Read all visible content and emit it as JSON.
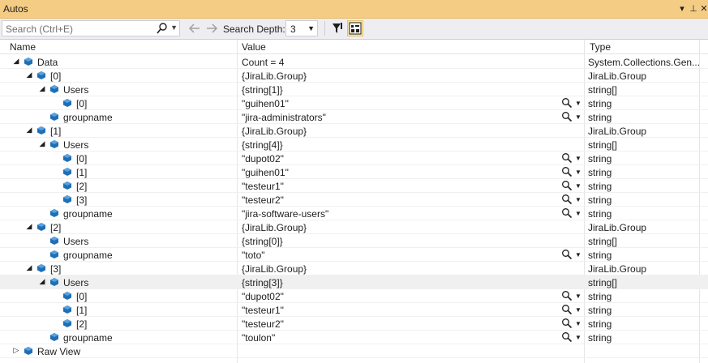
{
  "window": {
    "title": "Autos",
    "menu_icon": "▾",
    "pin_icon": "⊥",
    "close_icon": "✕"
  },
  "toolbar": {
    "search_placeholder": "Search (Ctrl+E)",
    "search_depth_label": "Search Depth:",
    "search_depth_value": "3"
  },
  "columns": {
    "name": "Name",
    "value": "Value",
    "type": "Type"
  },
  "rows": [
    {
      "name": "Data",
      "value": "Count = 4",
      "type": "System.Collections.Gen...",
      "level": 0,
      "expander": "expanded",
      "mag": false
    },
    {
      "name": "[0]",
      "value": "{JiraLib.Group}",
      "type": "JiraLib.Group",
      "level": 1,
      "expander": "expanded",
      "mag": false
    },
    {
      "name": "Users",
      "value": "{string[1]}",
      "type": "string[]",
      "level": 2,
      "expander": "expanded",
      "mag": false
    },
    {
      "name": "[0]",
      "value": "\"guihen01\"",
      "type": "string",
      "level": 3,
      "expander": "none",
      "mag": true
    },
    {
      "name": "groupname",
      "value": "\"jira-administrators\"",
      "type": "string",
      "level": 2,
      "expander": "none",
      "mag": true
    },
    {
      "name": "[1]",
      "value": "{JiraLib.Group}",
      "type": "JiraLib.Group",
      "level": 1,
      "expander": "expanded",
      "mag": false
    },
    {
      "name": "Users",
      "value": "{string[4]}",
      "type": "string[]",
      "level": 2,
      "expander": "expanded",
      "mag": false
    },
    {
      "name": "[0]",
      "value": "\"dupot02\"",
      "type": "string",
      "level": 3,
      "expander": "none",
      "mag": true
    },
    {
      "name": "[1]",
      "value": "\"guihen01\"",
      "type": "string",
      "level": 3,
      "expander": "none",
      "mag": true
    },
    {
      "name": "[2]",
      "value": "\"testeur1\"",
      "type": "string",
      "level": 3,
      "expander": "none",
      "mag": true
    },
    {
      "name": "[3]",
      "value": "\"testeur2\"",
      "type": "string",
      "level": 3,
      "expander": "none",
      "mag": true
    },
    {
      "name": "groupname",
      "value": "\"jira-software-users\"",
      "type": "string",
      "level": 2,
      "expander": "none",
      "mag": true
    },
    {
      "name": "[2]",
      "value": "{JiraLib.Group}",
      "type": "JiraLib.Group",
      "level": 1,
      "expander": "expanded",
      "mag": false
    },
    {
      "name": "Users",
      "value": "{string[0]}",
      "type": "string[]",
      "level": 2,
      "expander": "none",
      "mag": false
    },
    {
      "name": "groupname",
      "value": "\"toto\"",
      "type": "string",
      "level": 2,
      "expander": "none",
      "mag": true
    },
    {
      "name": "[3]",
      "value": "{JiraLib.Group}",
      "type": "JiraLib.Group",
      "level": 1,
      "expander": "expanded",
      "mag": false
    },
    {
      "name": "Users",
      "value": "{string[3]}",
      "type": "string[]",
      "level": 2,
      "expander": "expanded",
      "mag": false,
      "selected": true
    },
    {
      "name": "[0]",
      "value": "\"dupot02\"",
      "type": "string",
      "level": 3,
      "expander": "none",
      "mag": true
    },
    {
      "name": "[1]",
      "value": "\"testeur1\"",
      "type": "string",
      "level": 3,
      "expander": "none",
      "mag": true
    },
    {
      "name": "[2]",
      "value": "\"testeur2\"",
      "type": "string",
      "level": 3,
      "expander": "none",
      "mag": true
    },
    {
      "name": "groupname",
      "value": "\"toulon\"",
      "type": "string",
      "level": 2,
      "expander": "none",
      "mag": true
    },
    {
      "name": "Raw View",
      "value": "",
      "type": "",
      "level": 0,
      "expander": "collapsed",
      "mag": false
    }
  ],
  "colors": {
    "title_bar": "#f5cc84",
    "object_icon": "#1f6fb5",
    "toolbar_bg": "#eeeef2"
  }
}
